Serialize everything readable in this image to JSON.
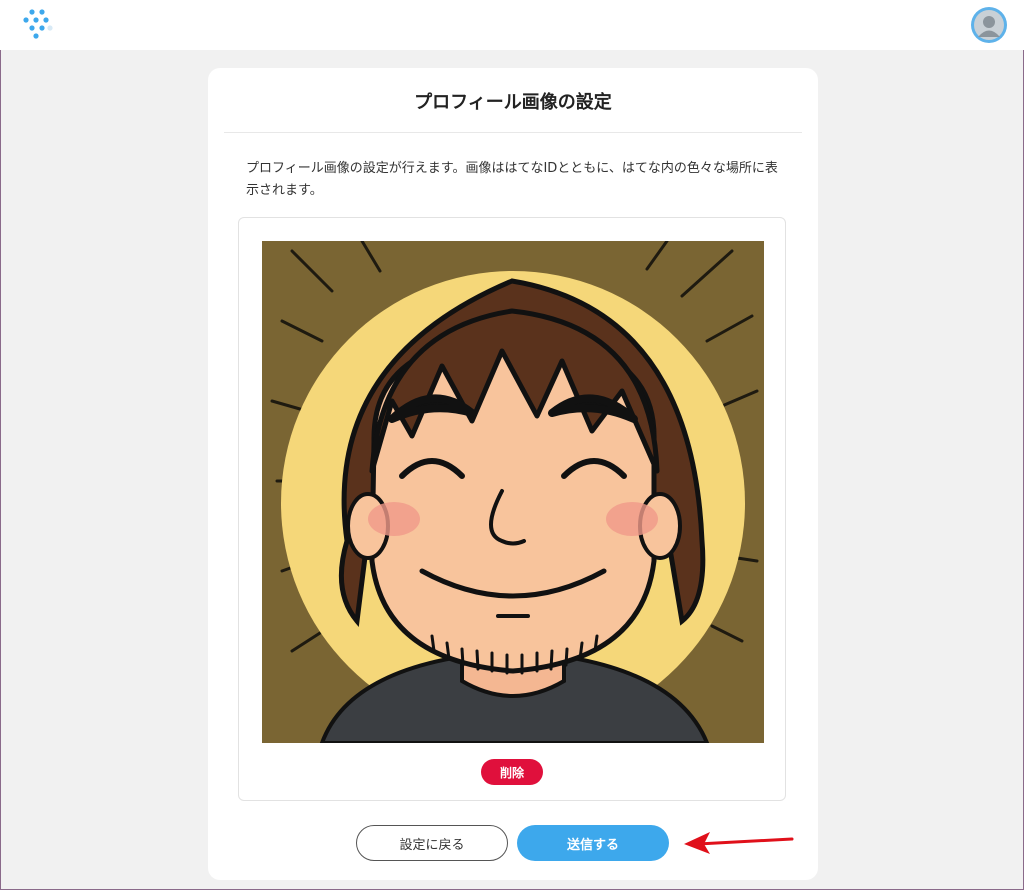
{
  "header": {
    "logo_icon": "hatena-dots-logo-icon",
    "avatar_icon": "user-avatar-icon",
    "accent_color": "#3da8ec"
  },
  "card": {
    "title": "プロフィール画像の設定",
    "description": "プロフィール画像の設定が行えます。画像ははてなIDとともに、はてな内の色々な場所に表示されます。",
    "image_icon": "profile-illustration-icon",
    "delete_label": "削除",
    "delete_color": "#e0103c",
    "back_label": "設定に戻る",
    "submit_label": "送信する"
  },
  "annotation": {
    "arrow_icon": "red-arrow-icon",
    "arrow_color": "#e0101a"
  }
}
